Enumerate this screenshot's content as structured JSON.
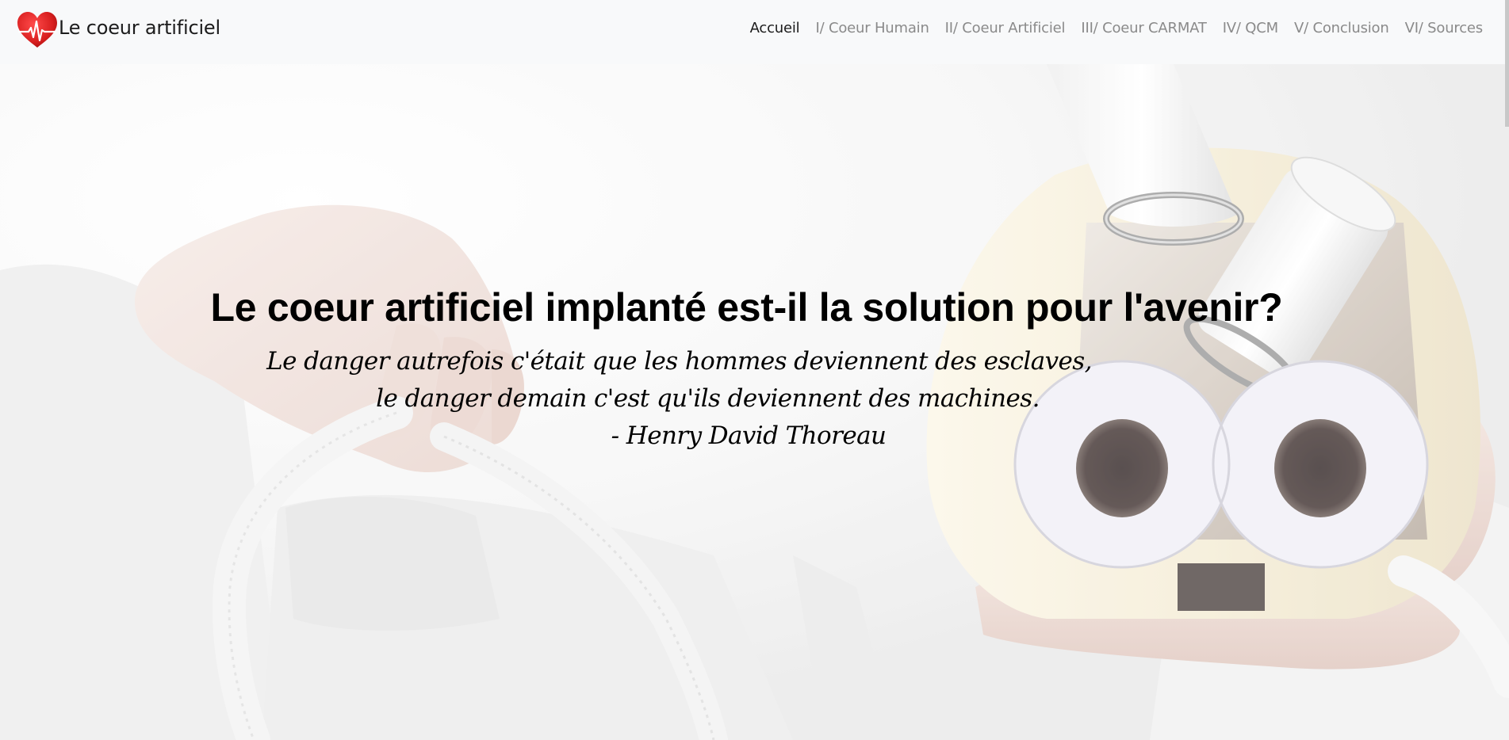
{
  "brand": {
    "title": "Le coeur artificiel",
    "logo_icon": "heartbeat-heart-icon",
    "logo_color": "#d81f1f"
  },
  "nav": {
    "items": [
      {
        "label": "Accueil",
        "active": true
      },
      {
        "label": "I/ Coeur Humain",
        "active": false
      },
      {
        "label": "II/ Coeur Artificiel",
        "active": false
      },
      {
        "label": "III/ Coeur CARMAT",
        "active": false
      },
      {
        "label": "IV/ QCM",
        "active": false
      },
      {
        "label": "V/ Conclusion",
        "active": false
      },
      {
        "label": "VI/ Sources",
        "active": false
      }
    ]
  },
  "hero": {
    "title": "Le coeur artificiel implanté est-il la solution pour l'avenir?",
    "quote_lines": [
      "Le danger autrefois c'était que les hommes deviennent des esclaves,",
      "le danger demain c'est qu'ils deviennent des machines.",
      "- Henry David Thoreau"
    ],
    "background": "photo-hands-holding-artificial-heart"
  },
  "colors": {
    "navbar_bg": "#f8f9fa",
    "nav_active": "#1a1a1a",
    "nav_inactive": "#8a8a8a",
    "text": "#000000"
  }
}
